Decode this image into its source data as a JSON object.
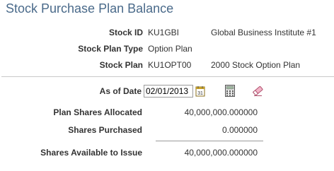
{
  "page_title": "Stock Purchase Plan Balance",
  "fields": {
    "stock_id": {
      "label": "Stock ID",
      "code": "KU1GBI",
      "description": "Global Business Institute #1"
    },
    "stock_plan_type": {
      "label": "Stock Plan Type",
      "value": "Option Plan"
    },
    "stock_plan": {
      "label": "Stock Plan",
      "code": "KU1OPT00",
      "description": "2000 Stock Option Plan"
    }
  },
  "as_of_date": {
    "label": "As of Date",
    "value": "02/01/2013"
  },
  "icons": {
    "calendar": "calendar-icon",
    "calculator": "calculator-icon",
    "eraser": "eraser-icon"
  },
  "totals": [
    {
      "label": "Plan Shares Allocated",
      "value": "40,000,000.000000"
    },
    {
      "label": "Shares Purchased",
      "value": "0.000000"
    },
    {
      "label": "Shares Available to Issue",
      "value": "40,000,000.000000"
    }
  ]
}
